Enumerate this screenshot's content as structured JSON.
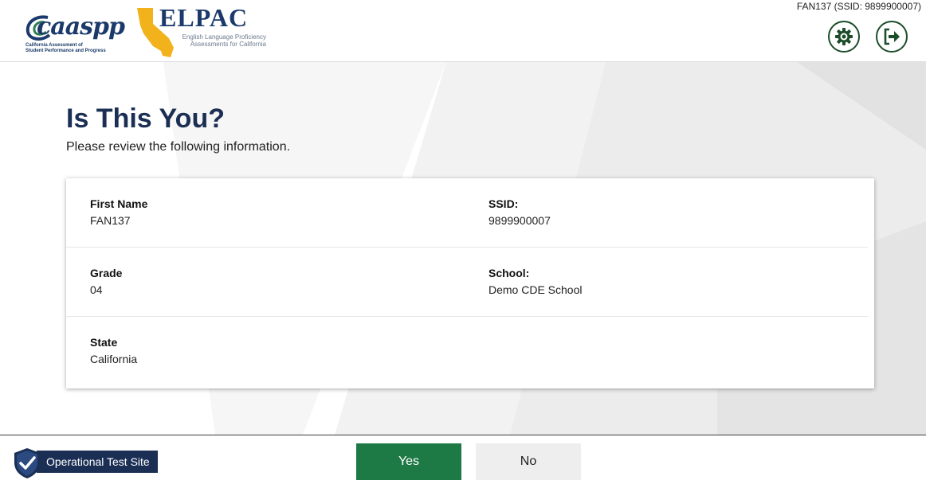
{
  "header": {
    "caaspp_logo": {
      "wordmark": "caaspp",
      "line1": "California Assessment of",
      "line2": "Student Performance and Progress"
    },
    "elpac_logo": {
      "wordmark": "ELPAC",
      "line1": "English Language Proficiency",
      "line2": "Assessments for California"
    },
    "user_id": "FAN137 (SSID: 9899900007)",
    "settings_icon": "gear-icon",
    "logout_icon": "logout-icon"
  },
  "main": {
    "title": "Is This You?",
    "subtitle": "Please review the following information.",
    "fields": {
      "first_name": {
        "label": "First Name",
        "value": "FAN137"
      },
      "ssid": {
        "label": "SSID:",
        "value": "9899900007"
      },
      "grade": {
        "label": "Grade",
        "value": "04"
      },
      "school": {
        "label": "School:",
        "value": "Demo CDE School"
      },
      "state": {
        "label": "State",
        "value": "California"
      }
    }
  },
  "footer": {
    "badge_label": "Operational Test Site",
    "badge_icon": "shield-check-icon",
    "yes_label": "Yes",
    "no_label": "No"
  },
  "colors": {
    "navy": "#1b2f55",
    "green": "#1e7a45",
    "icon_green": "#1c4d2a"
  }
}
